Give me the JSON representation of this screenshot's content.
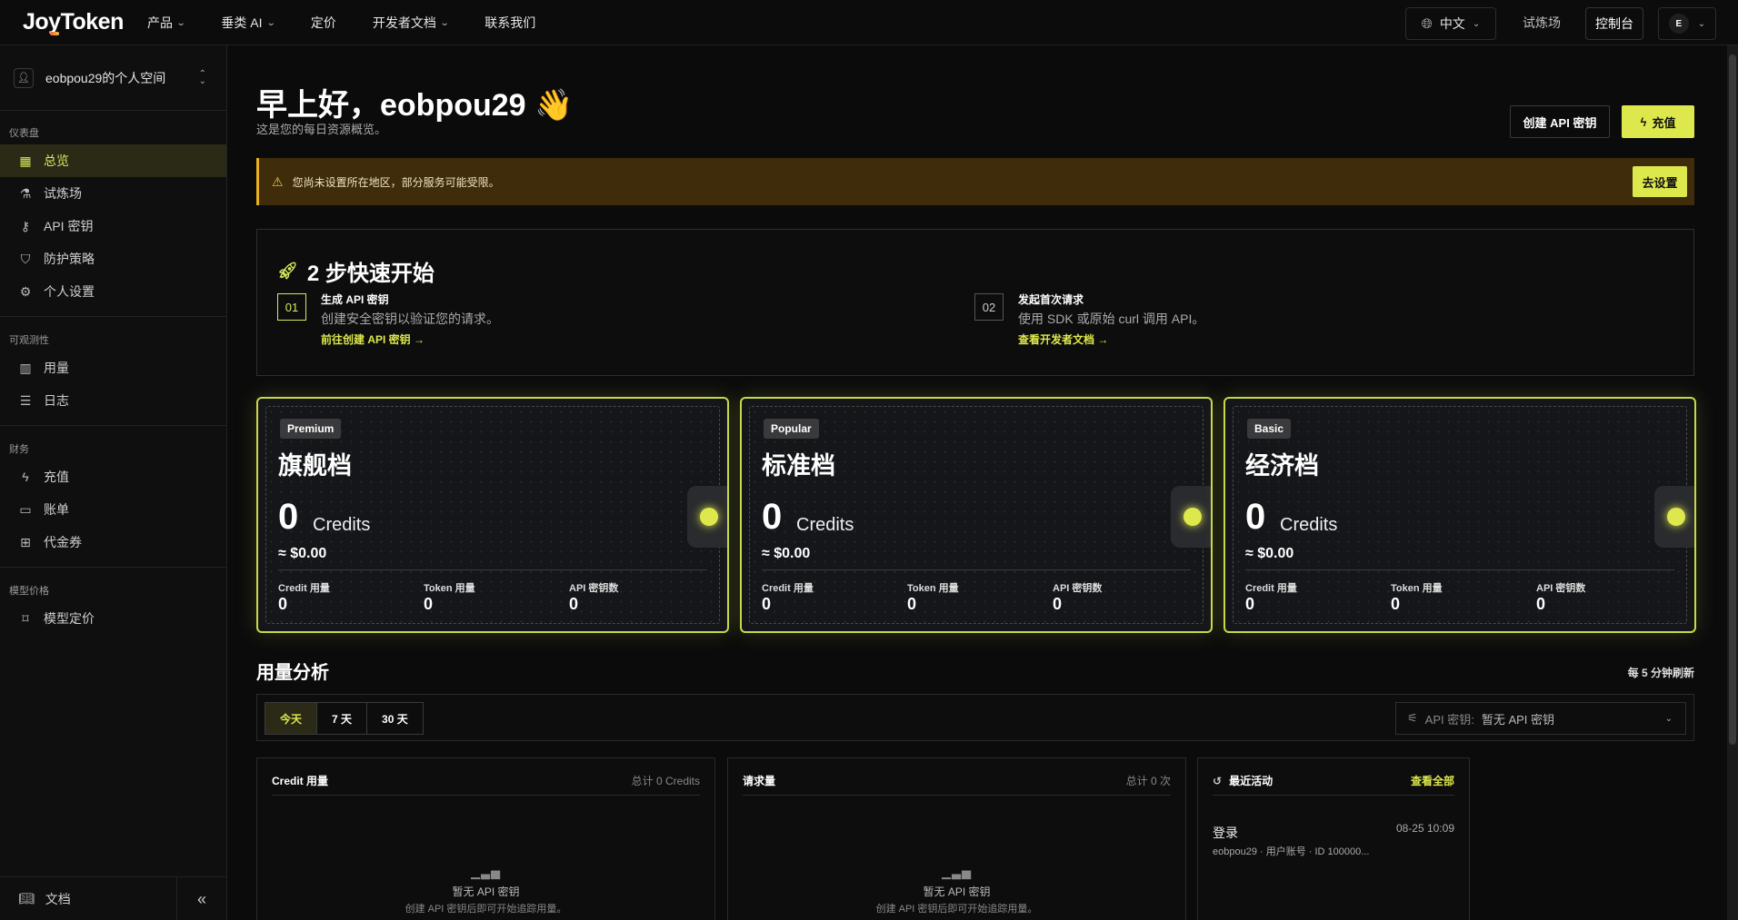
{
  "nav": {
    "logo": "JoyToken",
    "items": [
      {
        "label": "产品",
        "dropdown": true
      },
      {
        "label": "垂类 AI",
        "dropdown": true
      },
      {
        "label": "定价",
        "dropdown": false
      },
      {
        "label": "开发者文档",
        "dropdown": true
      },
      {
        "label": "联系我们",
        "dropdown": false
      }
    ],
    "language": "中文",
    "playground": "试炼场",
    "console": "控制台",
    "avatar_initial": "E"
  },
  "sidebar": {
    "space_name": "eobpou29的个人空间",
    "sections": {
      "dashboard": "仪表盘",
      "observability": "可观测性",
      "finance": "财务",
      "model_pricing": "模型价格"
    },
    "items": {
      "overview": "总览",
      "playground": "试炼场",
      "api_keys": "API 密钥",
      "protection": "防护策略",
      "settings": "个人设置",
      "usage": "用量",
      "logs": "日志",
      "recharge": "充值",
      "bills": "账单",
      "vouchers": "代金券",
      "model_pricing": "模型定价"
    },
    "docs": "文档"
  },
  "header": {
    "greeting": "早上好，eobpou29 👋",
    "subtitle": "这是您的每日资源概览。",
    "create_key": "创建 API 密钥",
    "recharge": "充值"
  },
  "alert": {
    "text": "您尚未设置所在地区，部分服务可能受限。",
    "action": "去设置"
  },
  "quickstart": {
    "title": "2 步快速开始",
    "steps": [
      {
        "num": "01",
        "title": "生成 API 密钥",
        "desc": "创建安全密钥以验证您的请求。",
        "link": "前往创建 API 密钥 →"
      },
      {
        "num": "02",
        "title": "发起首次请求",
        "desc": "使用 SDK 或原始 curl 调用 API。",
        "link": "查看开发者文档 →"
      }
    ]
  },
  "tiers": [
    {
      "badge": "Premium",
      "name": "旗舰档",
      "credits": "0",
      "unit": "Credits",
      "usd": "≈ $0.00",
      "stats": [
        {
          "label": "Credit 用量",
          "value": "0"
        },
        {
          "label": "Token 用量",
          "value": "0"
        },
        {
          "label": "API 密钥数",
          "value": "0"
        }
      ]
    },
    {
      "badge": "Popular",
      "name": "标准档",
      "credits": "0",
      "unit": "Credits",
      "usd": "≈ $0.00",
      "stats": [
        {
          "label": "Credit 用量",
          "value": "0"
        },
        {
          "label": "Token 用量",
          "value": "0"
        },
        {
          "label": "API 密钥数",
          "value": "0"
        }
      ]
    },
    {
      "badge": "Basic",
      "name": "经济档",
      "credits": "0",
      "unit": "Credits",
      "usd": "≈ $0.00",
      "stats": [
        {
          "label": "Credit 用量",
          "value": "0"
        },
        {
          "label": "Token 用量",
          "value": "0"
        },
        {
          "label": "API 密钥数",
          "value": "0"
        }
      ]
    }
  ],
  "usage": {
    "title": "用量分析",
    "refresh_note": "每 5 分钟刷新",
    "ranges": [
      "今天",
      "7 天",
      "30 天"
    ],
    "key_filter_label": "API 密钥:",
    "key_filter_value": "暂无 API 密钥",
    "credit_panel": {
      "title": "Credit 用量",
      "total": "总计 0 Credits",
      "empty_title": "暂无 API 密钥",
      "empty_desc": "创建 API 密钥后即可开始追踪用量。"
    },
    "request_panel": {
      "title": "请求量",
      "total": "总计 0 次",
      "empty_title": "暂无 API 密钥",
      "empty_desc": "创建 API 密钥后即可开始追踪用量。"
    }
  },
  "activity": {
    "title": "最近活动",
    "view_all": "查看全部",
    "items": [
      {
        "title": "登录",
        "time": "08-25 10:09",
        "desc": "eobpou29 · 用户账号 · ID 100000..."
      }
    ]
  },
  "colors": {
    "accent": "#dde84c",
    "warning_bg": "#3e2c0a",
    "warning_border": "#e6b11d",
    "background": "#0b0b0c"
  }
}
